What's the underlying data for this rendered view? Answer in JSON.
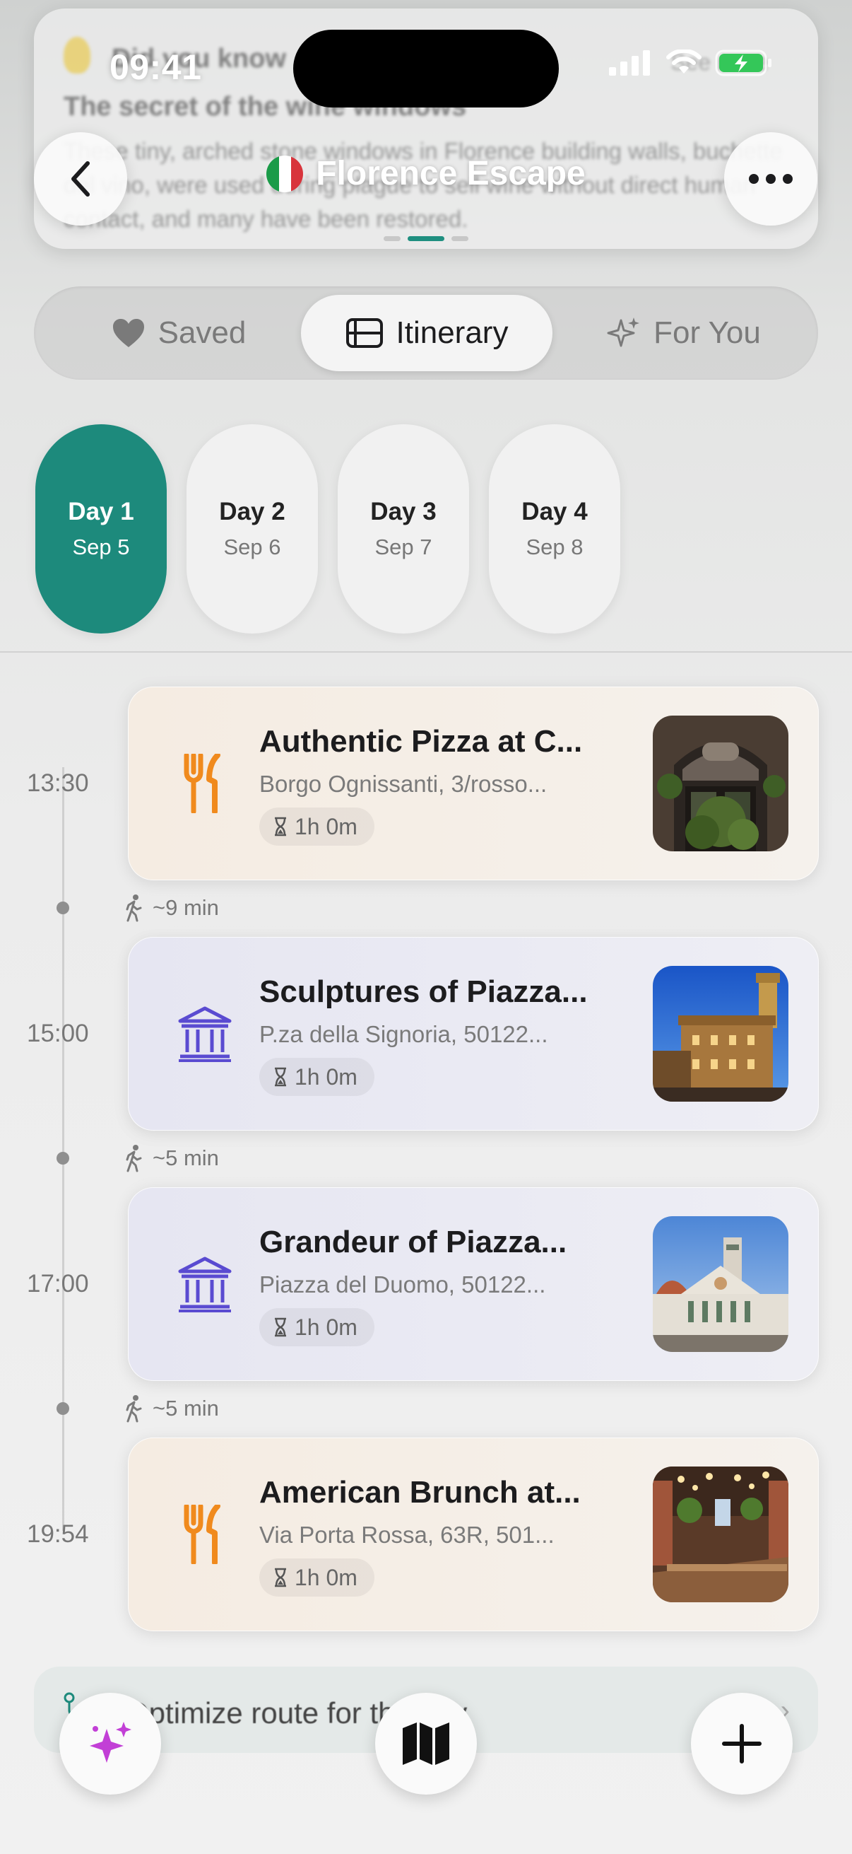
{
  "status_bar": {
    "time": "09:41"
  },
  "tip": {
    "kicker": "Did you know",
    "more": "See more",
    "title": "The secret of the wine windows",
    "body": "These tiny, arched stone windows in Florence building walls, buchette del vino, were used during plague to sell wine without direct human contact, and many have been restored."
  },
  "header": {
    "title": "Florence Escape",
    "flag_colors": [
      "#1a9b48",
      "#ffffff",
      "#d8343c"
    ]
  },
  "tabs": [
    {
      "label": "Saved",
      "icon": "heart-icon"
    },
    {
      "label": "Itinerary",
      "icon": "list-icon",
      "selected": true
    },
    {
      "label": "For You",
      "icon": "sparkle-icon"
    }
  ],
  "days": [
    {
      "day": "Day 1",
      "date": "Sep 5",
      "selected": true
    },
    {
      "day": "Day 2",
      "date": "Sep 6"
    },
    {
      "day": "Day 3",
      "date": "Sep 7"
    },
    {
      "day": "Day 4",
      "date": "Sep 8"
    }
  ],
  "itinerary": [
    {
      "time": "13:30",
      "title": "Authentic Pizza at C...",
      "address": "Borgo Ognissanti, 3/rosso...",
      "duration": "1h 0m",
      "category": "food",
      "icon": "fork-knife-icon",
      "image": "cafe-storefront"
    },
    {
      "time": "15:00",
      "title": "Sculptures of Piazza...",
      "address": "P.za della Signoria, 50122...",
      "duration": "1h 0m",
      "category": "museum",
      "icon": "museum-icon",
      "image": "palazzo-vecchio"
    },
    {
      "time": "17:00",
      "title": "Grandeur of Piazza...",
      "address": "Piazza del Duomo, 50122...",
      "duration": "1h 0m",
      "category": "museum",
      "icon": "museum-icon",
      "image": "duomo"
    },
    {
      "time": "19:54",
      "title": "American Brunch at...",
      "address": "Via Porta Rossa, 63R, 501...",
      "duration": "1h 0m",
      "category": "food",
      "icon": "fork-knife-icon",
      "image": "restaurant-interior"
    }
  ],
  "walks": [
    "~9 min",
    "~5 min",
    "~5 min"
  ],
  "optimize": {
    "label": "Optimize route for the day"
  },
  "colors": {
    "accent": "#1d8a7c",
    "food": "#f08a1d",
    "museum": "#5a4bd1",
    "sparkle": "#c23fd6"
  }
}
